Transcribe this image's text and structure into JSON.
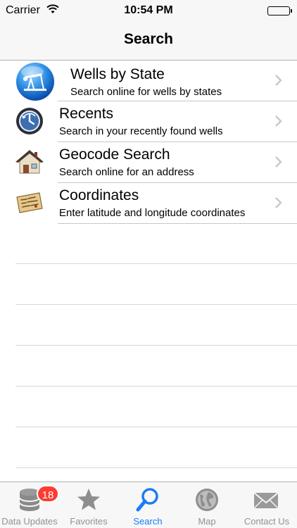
{
  "status_bar": {
    "carrier": "Carrier",
    "time": "10:54 PM"
  },
  "nav": {
    "title": "Search"
  },
  "rows": [
    {
      "title": "Wells by State",
      "subtitle": "Search online for wells by states",
      "icon": "oil-pump-icon"
    },
    {
      "title": "Recents",
      "subtitle": "Search in your recently found wells",
      "icon": "history-clock-icon"
    },
    {
      "title": "Geocode Search",
      "subtitle": "Search online for an address",
      "icon": "house-icon"
    },
    {
      "title": "Coordinates",
      "subtitle": "Enter latitude and longitude coordinates",
      "icon": "map-note-icon"
    }
  ],
  "tabs": [
    {
      "label": "Data Updates",
      "icon": "database-icon",
      "badge": "18"
    },
    {
      "label": "Favorites",
      "icon": "star-icon"
    },
    {
      "label": "Search",
      "icon": "magnifier-icon",
      "active": true
    },
    {
      "label": "Map",
      "icon": "globe-icon"
    },
    {
      "label": "Contact Us",
      "icon": "envelope-icon"
    }
  ],
  "colors": {
    "accent": "#1a7cf5",
    "inactive": "#929292",
    "badge": "#fd3b30",
    "bar": "#f7f7f7"
  }
}
